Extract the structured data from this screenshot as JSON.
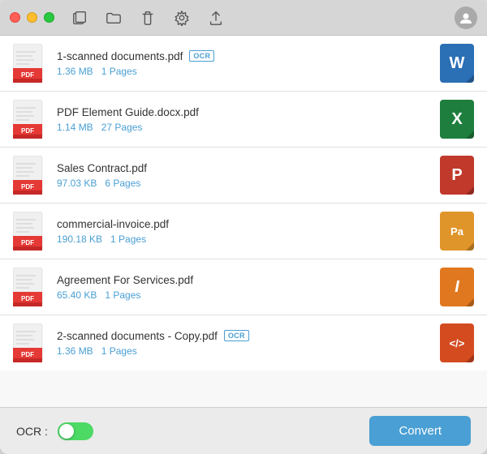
{
  "titlebar": {
    "trafficLights": {
      "close": "close",
      "minimize": "minimize",
      "maximize": "maximize"
    }
  },
  "toolbar": {
    "icons": [
      "new-window-icon",
      "folder-icon",
      "trash-icon",
      "settings-icon",
      "upload-icon"
    ]
  },
  "files": [
    {
      "name": "1-scanned documents.pdf",
      "hasOcr": true,
      "size": "1.36 MB",
      "pages": "1 Pages",
      "outputType": "W",
      "outputColor": "#2b6fb5",
      "outputColorDark": "#1e5a9e"
    },
    {
      "name": "PDF Element Guide.docx.pdf",
      "hasOcr": false,
      "size": "1.14 MB",
      "pages": "27 Pages",
      "outputType": "X",
      "outputColor": "#1e7e3e",
      "outputColorDark": "#155c2d"
    },
    {
      "name": "Sales Contract.pdf",
      "hasOcr": false,
      "size": "97.03 KB",
      "pages": "6 Pages",
      "outputType": "P",
      "outputColor": "#c0392b",
      "outputColorDark": "#9b2c21"
    },
    {
      "name": "commercial-invoice.pdf",
      "hasOcr": false,
      "size": "190.18 KB",
      "pages": "1 Pages",
      "outputType": "Pa",
      "outputColor": "#e0952a",
      "outputColorDark": "#c07d1a"
    },
    {
      "name": "Agreement For Services.pdf",
      "hasOcr": false,
      "size": "65.40 KB",
      "pages": "1 Pages",
      "outputType": "I",
      "outputColor": "#e07820",
      "outputColorDark": "#c06010"
    },
    {
      "name": "2-scanned documents - Copy.pdf",
      "hasOcr": true,
      "size": "1.36 MB",
      "pages": "1 Pages",
      "outputType": "</>",
      "outputColor": "#d44b20",
      "outputColorDark": "#b83a15"
    }
  ],
  "bottomBar": {
    "ocrLabel": "OCR :",
    "convertLabel": "Convert"
  },
  "ocrBadgeText": "OCR"
}
